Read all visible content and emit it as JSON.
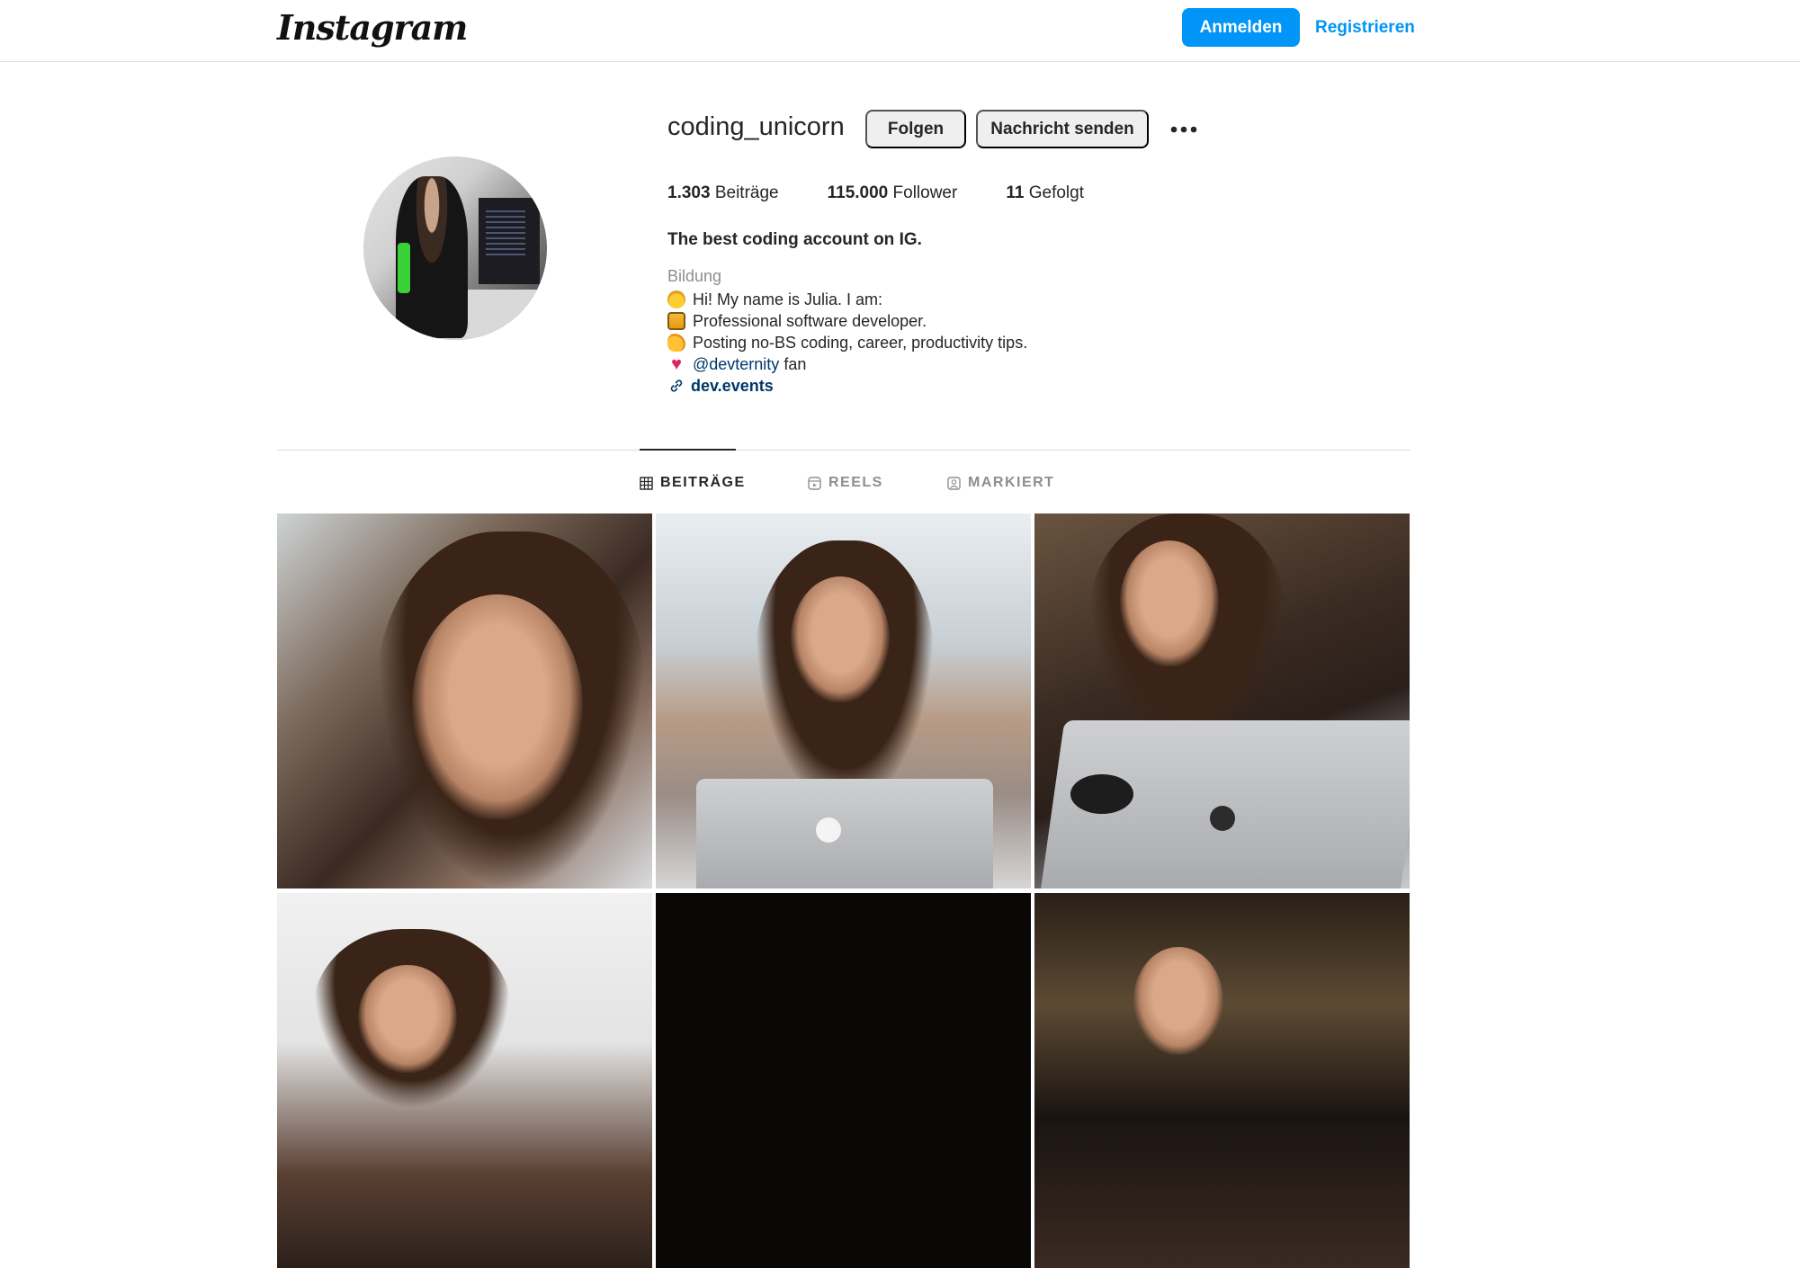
{
  "topbar": {
    "logo": "Instagram",
    "login_label": "Anmelden",
    "register_label": "Registrieren",
    "accent_color": "#0095f6"
  },
  "profile": {
    "username": "coding_unicorn",
    "follow_label": "Folgen",
    "message_label": "Nachricht senden",
    "more_icon": "more-horizontal-icon",
    "stats": {
      "posts_count": "1.303",
      "posts_label": "Beiträge",
      "followers_count": "115.000",
      "followers_label": "Follower",
      "following_count": "11",
      "following_label": "Gefolgt"
    },
    "bio": {
      "name": "The best coding account on IG.",
      "category": "Bildung",
      "lines": [
        {
          "icon": "waving-hand-emoji",
          "text": "Hi! My name is Julia. I am:"
        },
        {
          "icon": "computer-emoji",
          "text": "Professional software developer."
        },
        {
          "icon": "flexed-biceps-emoji",
          "text": "Posting no-BS coding, career, productivity tips."
        }
      ],
      "heart_line": {
        "icon": "red-heart-emoji",
        "mention": "@devternity",
        "suffix": " fan"
      },
      "link": {
        "icon": "link-icon",
        "text": "dev.events"
      }
    }
  },
  "tabs": [
    {
      "label": "BEITRÄGE",
      "icon": "grid-icon",
      "active": true
    },
    {
      "label": "REELS",
      "icon": "reels-icon",
      "active": false
    },
    {
      "label": "MARKIERT",
      "icon": "tagged-icon",
      "active": false
    }
  ],
  "posts": [
    {
      "kind": "selfie-portrait"
    },
    {
      "kind": "laptop-window-city"
    },
    {
      "kind": "laptop-dark-room"
    },
    {
      "kind": "selfie-peace-sign"
    },
    {
      "kind": "dark-image"
    },
    {
      "kind": "night-city"
    }
  ]
}
